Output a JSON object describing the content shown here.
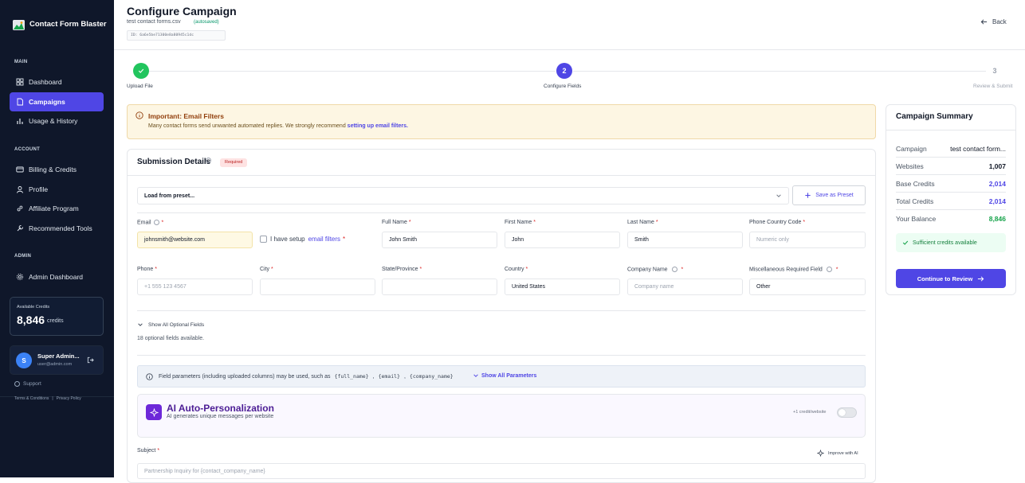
{
  "app": {
    "title": "Contact Form Blaster"
  },
  "sidebar": {
    "main_label": "MAIN",
    "main_items": [
      {
        "label": "Dashboard",
        "icon": "grid-icon"
      },
      {
        "label": "Campaigns",
        "icon": "file-icon",
        "active": true
      },
      {
        "label": "Usage & History",
        "icon": "bar-chart-icon"
      }
    ],
    "account_label": "ACCOUNT",
    "account_items": [
      {
        "label": "Billing & Credits",
        "icon": "credit-card-icon"
      },
      {
        "label": "Profile",
        "icon": "user-icon"
      },
      {
        "label": "Affiliate Program",
        "icon": "link-icon"
      },
      {
        "label": "Recommended Tools",
        "icon": "wrench-icon"
      }
    ],
    "admin_label": "ADMIN",
    "admin_items": [
      {
        "label": "Admin Dashboard",
        "icon": "gear-icon"
      }
    ],
    "credits": {
      "label": "Available Credits",
      "value": "8,846",
      "unit": "credits"
    },
    "user": {
      "initial": "S",
      "name": "Super Admin...",
      "email": "user@admin.com"
    },
    "support": "Support",
    "terms": "Terms & Conditions",
    "separator": "|",
    "privacy": "Privacy Policy"
  },
  "header": {
    "title": "Configure Campaign",
    "file": "test contact forms.csv",
    "autosaved": "(autosaved)",
    "id": "ID: 6a6e5be71300e8a80945c1dc",
    "back": "Back"
  },
  "stepper": {
    "steps": [
      {
        "label": "Upload File",
        "state": "done"
      },
      {
        "label": "Configure Fields",
        "number": "2",
        "state": "active"
      },
      {
        "label": "Review & Submit",
        "number": "3",
        "state": "pending"
      }
    ]
  },
  "alert": {
    "title": "Important: Email Filters",
    "text": "Many contact forms send unwanted automated replies. We strongly recommend",
    "link": "setting up email filters."
  },
  "submission": {
    "title": "Submission Details",
    "required_badge": "Required",
    "preset_placeholder": "Load from preset...",
    "save_preset": "Save as Preset",
    "checkbox_text": "I have setup",
    "checkbox_link": "email filters",
    "fields": {
      "email": {
        "label": "Email",
        "value": "johnsmith@website.com"
      },
      "full_name": {
        "label": "Full Name",
        "value": "John Smith"
      },
      "first_name": {
        "label": "First Name",
        "value": "John"
      },
      "last_name": {
        "label": "Last Name",
        "value": "Smith"
      },
      "phone_country": {
        "label": "Phone Country Code",
        "placeholder": "Numeric only"
      },
      "phone": {
        "label": "Phone",
        "placeholder": "+1 555 123 4567"
      },
      "city": {
        "label": "City",
        "value": ""
      },
      "state": {
        "label": "State/Province",
        "value": ""
      },
      "country": {
        "label": "Country",
        "value": "United States"
      },
      "company": {
        "label": "Company Name",
        "placeholder": "Company name"
      },
      "misc": {
        "label": "Miscellaneous Required Field",
        "value": "Other"
      }
    },
    "optional_toggle": "Show All Optional Fields",
    "optional_count": "18 optional fields available.",
    "params_text": "Field parameters (including uploaded columns) may be used, such as",
    "params": [
      "{full_name}",
      "{email}",
      "{company_name}"
    ],
    "params_toggle": "Show All Parameters",
    "ai": {
      "title": "AI Auto-Personalization",
      "subtitle": "AI generates unique messages per website",
      "cost": "+1 credit/website",
      "enabled": false
    },
    "subject": {
      "label": "Subject",
      "improve": "Improve with AI",
      "placeholder": "Partnership Inquiry for {contact_company_name}"
    }
  },
  "summary": {
    "title": "Campaign Summary",
    "rows": [
      {
        "label": "Campaign",
        "value": "test contact form..."
      },
      {
        "label": "Websites",
        "value": "1,007"
      },
      {
        "label": "Base Credits",
        "value": "2,014"
      },
      {
        "label": "Total Credits",
        "value": "2,014"
      },
      {
        "label": "Your Balance",
        "value": "8,846"
      }
    ],
    "status": "Sufficient credits available",
    "continue": "Continue to Review",
    "colors": {
      "accent": "#4f46e5",
      "success": "#16a34a"
    }
  }
}
